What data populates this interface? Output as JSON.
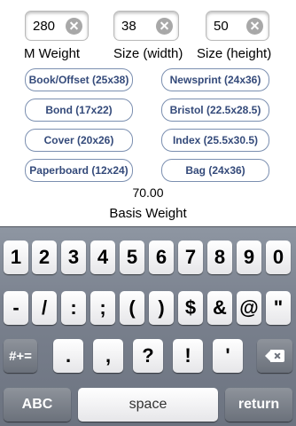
{
  "fields": [
    {
      "name": "m-weight",
      "value": "280",
      "label": "M Weight"
    },
    {
      "name": "size-width",
      "value": "38",
      "label": "Size (width)"
    },
    {
      "name": "size-height",
      "value": "50",
      "label": "Size (height)"
    }
  ],
  "paper_types": {
    "book_offset": "Book/Offset (25x38)",
    "newsprint": "Newsprint (24x36)",
    "bond": "Bond (17x22)",
    "bristol": "Bristol (22.5x28.5)",
    "cover": "Cover  (20x26)",
    "index": "Index (25.5x30.5)",
    "paperboard": "Paperboard (12x24)",
    "bag": "Bag (24x36)"
  },
  "result": {
    "value": "70.00",
    "label": "Basis Weight"
  },
  "keyboard": {
    "row1": [
      "1",
      "2",
      "3",
      "4",
      "5",
      "6",
      "7",
      "8",
      "9",
      "0"
    ],
    "row2": [
      "-",
      "/",
      ":",
      ";",
      "(",
      ")",
      "$",
      "&",
      "@",
      "\""
    ],
    "row3": {
      "mode_key": "#+=",
      "keys": [
        ".",
        ",",
        "?",
        "!",
        "'"
      ]
    },
    "row4": {
      "abc": "ABC",
      "space": "space",
      "return": "return"
    }
  }
}
